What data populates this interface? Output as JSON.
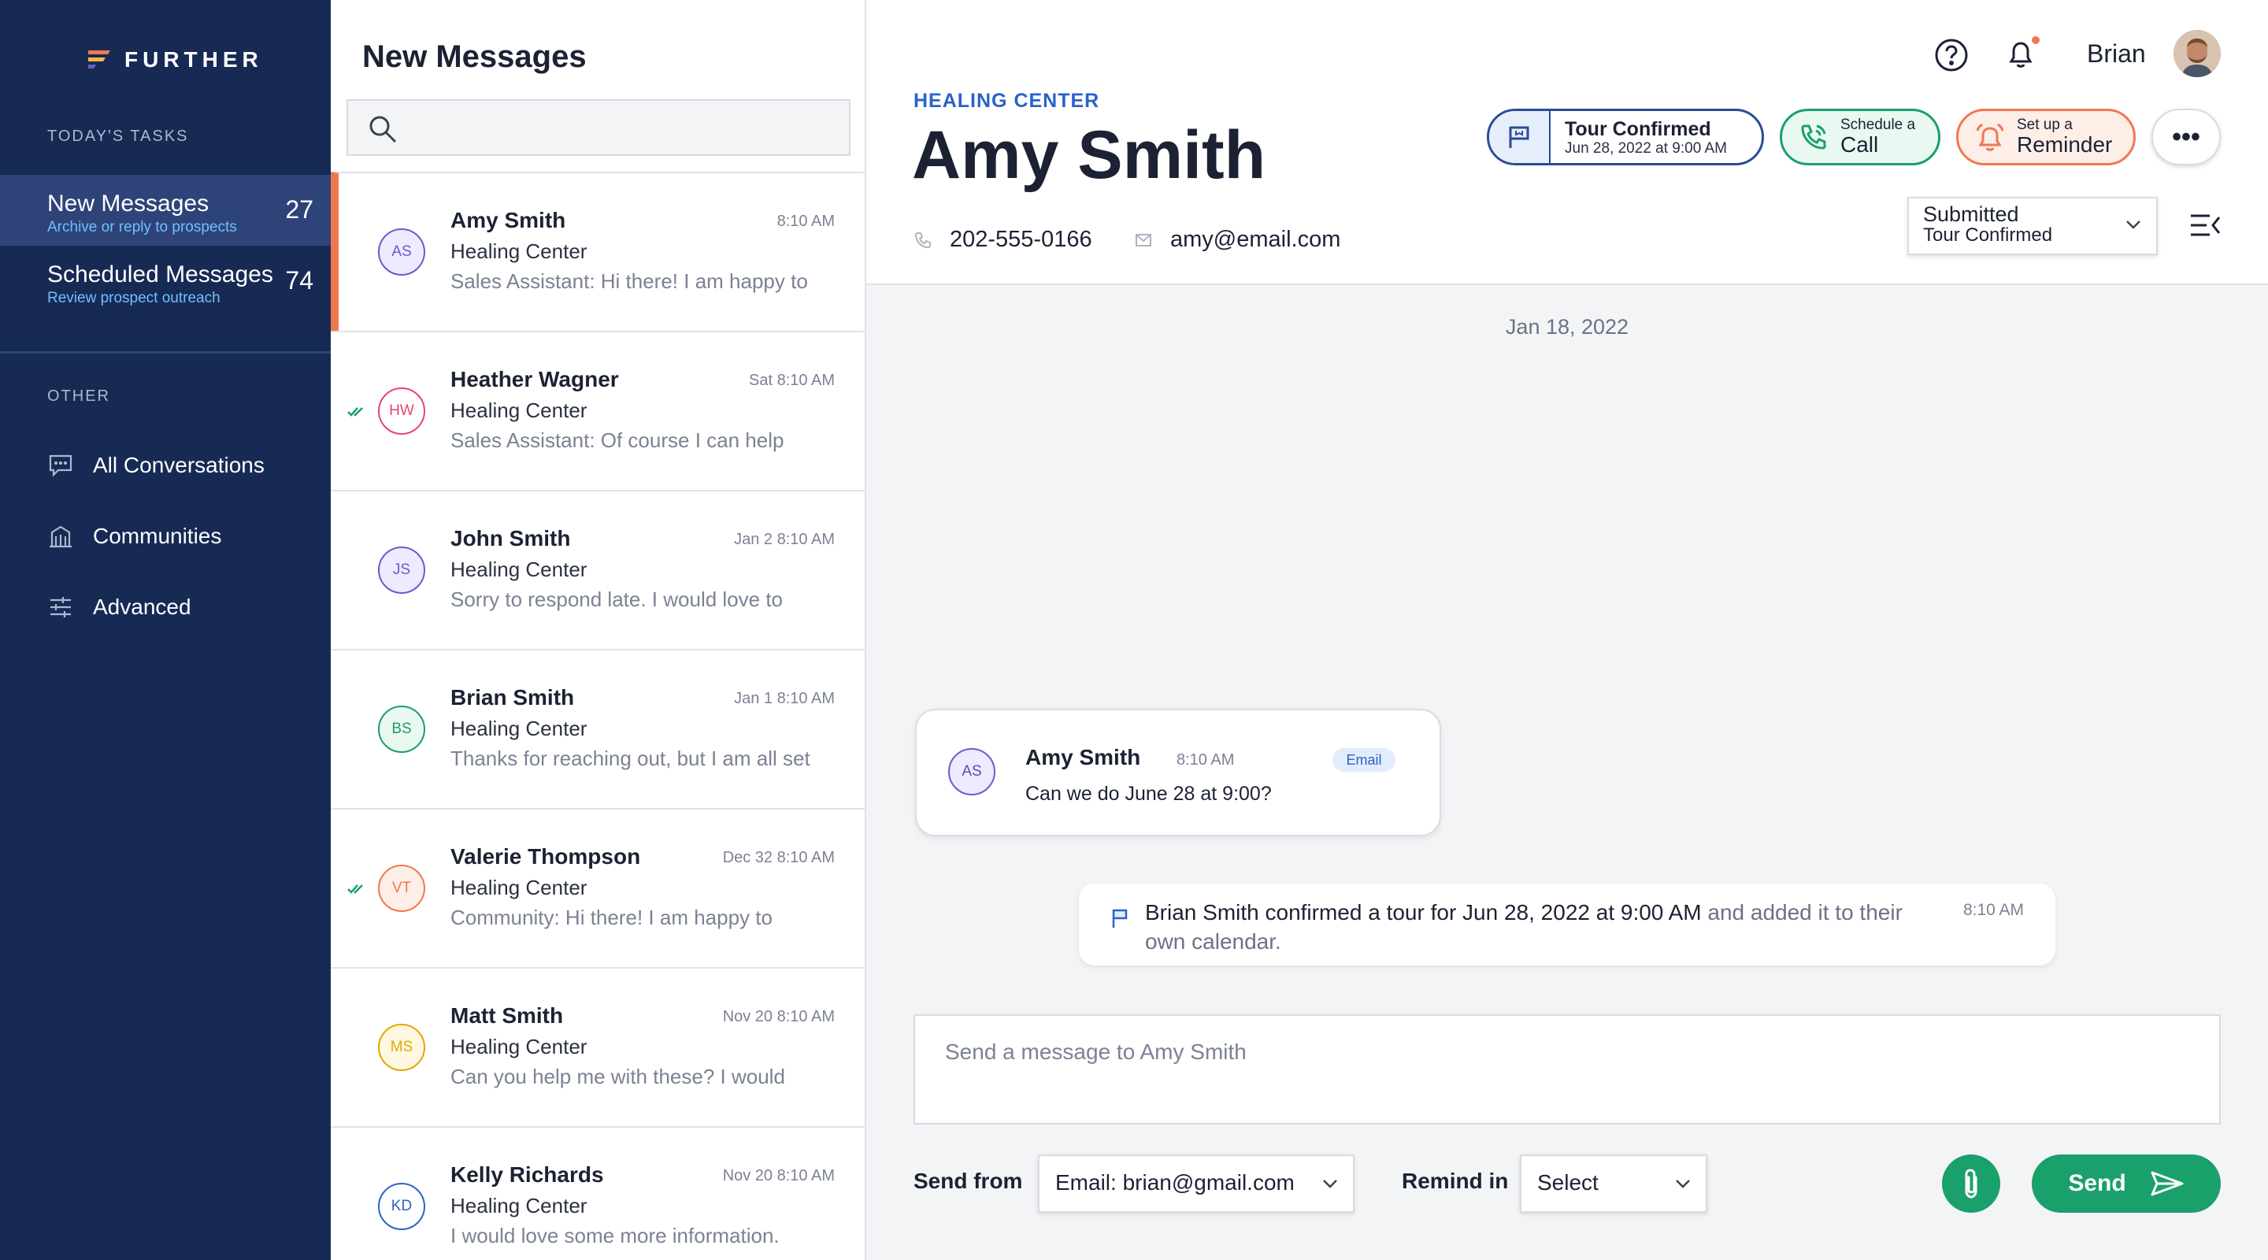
{
  "brand": {
    "name": "FURTHER"
  },
  "sidebar": {
    "todays_tasks_heading": "TODAY'S TASKS",
    "tasks": [
      {
        "title": "New Messages",
        "subtitle": "Archive or reply to prospects",
        "count": "27",
        "active": true
      },
      {
        "title": "Scheduled Messages",
        "subtitle": "Review prospect outreach",
        "count": "74",
        "active": false
      }
    ],
    "other_heading": "OTHER",
    "nav": [
      {
        "label": "All Conversations",
        "icon": "chat-icon"
      },
      {
        "label": "Communities",
        "icon": "building-icon"
      },
      {
        "label": "Advanced",
        "icon": "sliders-icon"
      }
    ]
  },
  "list": {
    "title": "New Messages",
    "search_placeholder": "",
    "conversations": [
      {
        "initials": "AS",
        "name": "Amy Smith",
        "time": "8:10 AM",
        "community": "Healing Center",
        "preview": "Sales Assistant: Hi there! I am happy to",
        "color": "#6a5bc9",
        "bg": "#eeeaff",
        "checked": false,
        "selected": true
      },
      {
        "initials": "HW",
        "name": "Heather Wagner",
        "time": "Sat 8:10 AM",
        "community": "Healing Center",
        "preview": "Sales Assistant: Of course I can help",
        "color": "#e8456b",
        "bg": "#ffffff",
        "checked": true,
        "selected": false
      },
      {
        "initials": "JS",
        "name": "John Smith",
        "time": "Jan 2 8:10 AM",
        "community": "Healing Center",
        "preview": "Sorry to respond late. I would love to",
        "color": "#6a5bc9",
        "bg": "#eeeaff",
        "checked": false,
        "selected": false
      },
      {
        "initials": "BS",
        "name": "Brian Smith",
        "time": "Jan 1 8:10 AM",
        "community": "Healing Center",
        "preview": "Thanks for reaching out, but I am all set",
        "color": "#1aa06b",
        "bg": "#eaf8f1",
        "checked": false,
        "selected": false
      },
      {
        "initials": "VT",
        "name": "Valerie Thompson",
        "time": "Dec 32 8:10 AM",
        "community": "Healing Center",
        "preview": "Community: Hi there! I am happy to",
        "color": "#f07850",
        "bg": "#fdeee7",
        "checked": true,
        "selected": false
      },
      {
        "initials": "MS",
        "name": "Matt Smith",
        "time": "Nov 20 8:10 AM",
        "community": "Healing Center",
        "preview": "Can you help me with these? I would",
        "color": "#e0a800",
        "bg": "#fff8e0",
        "checked": false,
        "selected": false
      },
      {
        "initials": "KD",
        "name": "Kelly Richards",
        "time": "Nov 20 8:10 AM",
        "community": "Healing Center",
        "preview": "I would love some more information.",
        "color": "#2a62c9",
        "bg": "#ffffff",
        "checked": false,
        "selected": false
      }
    ]
  },
  "header": {
    "community": "HEALING CENTER",
    "contact_name": "Amy Smith",
    "phone": "202-555-0166",
    "email": "amy@email.com",
    "user_name": "Brian",
    "tour_pill": {
      "title": "Tour Confirmed",
      "subtitle": "Jun 28, 2022 at 9:00 AM"
    },
    "call_pill": {
      "small": "Schedule a",
      "big": "Call"
    },
    "reminder_pill": {
      "small": "Set up a",
      "big": "Reminder"
    },
    "more_label": "•••",
    "status": {
      "line1": "Submitted",
      "line2": "Tour Confirmed"
    }
  },
  "thread": {
    "date": "Jan 18, 2022",
    "message": {
      "initials": "AS",
      "name": "Amy Smith",
      "time": "8:10 AM",
      "channel": "Email",
      "text": "Can we do June 28 at 9:00?"
    },
    "event": {
      "main": "Brian Smith confirmed a tour for Jun 28, 2022 at 9:00 AM",
      "rest": " and added it to their own calendar.",
      "time": "8:10 AM"
    }
  },
  "composer": {
    "placeholder": "Send a message to Amy Smith",
    "send_from_label": "Send from",
    "send_from_value": "Email: brian@gmail.com",
    "remind_label": "Remind in",
    "remind_value": "Select",
    "send_label": "Send"
  },
  "colors": {
    "sidebar": "#172a54",
    "accent_green": "#1aa06b",
    "accent_orange": "#f07850",
    "accent_blue": "#2a62c9"
  }
}
